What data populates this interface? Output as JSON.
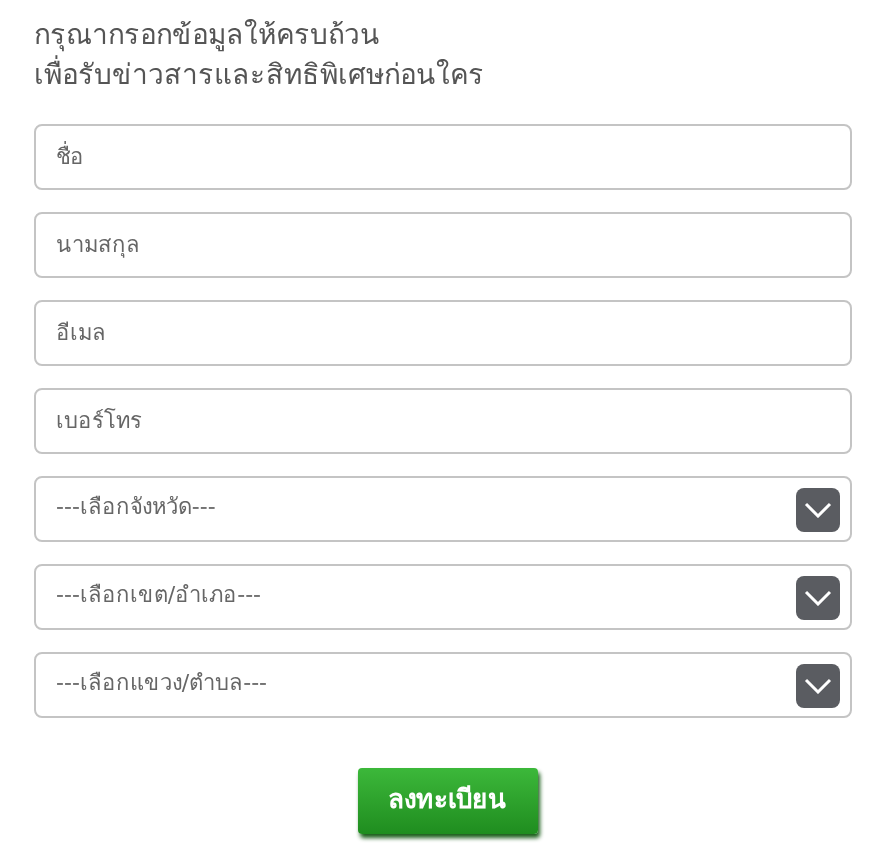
{
  "heading": [
    "กรุณากรอกข้อมูลให้ครบถ้วน",
    "เพื่อรับข่าวสารและสิทธิพิเศษก่อนใคร"
  ],
  "fields": [
    {
      "kind": "text",
      "placeholder": "ชื่อ"
    },
    {
      "kind": "text",
      "placeholder": "นามสกุล"
    },
    {
      "kind": "text",
      "placeholder": "อีเมล"
    },
    {
      "kind": "text",
      "placeholder": "เบอร์โทร"
    },
    {
      "kind": "select",
      "value": "---เลือกจังหวัด---"
    },
    {
      "kind": "select",
      "value": "---เลือกเขต/อำเภอ---"
    },
    {
      "kind": "select",
      "value": "---เลือกแขวง/ตำบล---"
    }
  ],
  "submit": "ลงทะเบียน"
}
